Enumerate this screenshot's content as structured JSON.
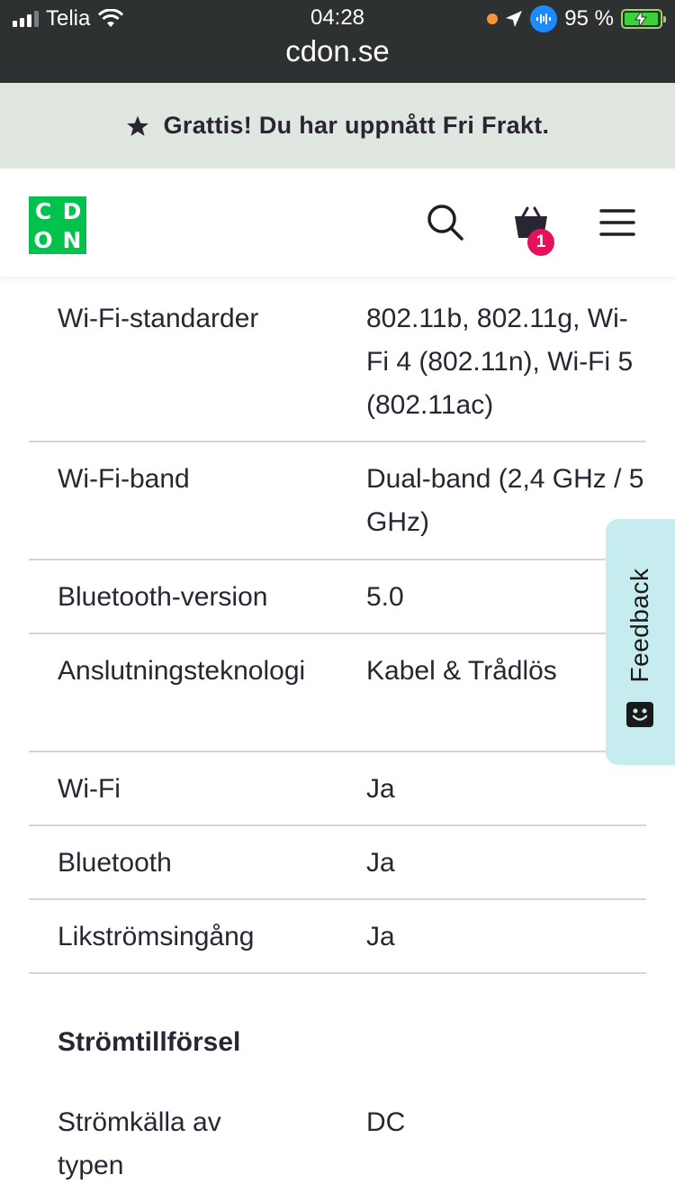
{
  "status_bar": {
    "carrier": "Telia",
    "time": "04:28",
    "battery": "95 %"
  },
  "browser": {
    "url": "cdon.se"
  },
  "promo": {
    "text": "Grattis! Du har uppnått Fri Frakt.",
    "icon": "star-icon"
  },
  "header": {
    "logo_letters": [
      "C",
      "D",
      "O",
      "N"
    ],
    "cart_count": "1",
    "colors": {
      "logo_bg": "#00c24d",
      "badge_bg": "#e5115a"
    }
  },
  "specs": [
    {
      "label": "Wi-Fi-standarder",
      "value": "802.11b, 802.11g, Wi-Fi 4 (802.11n), Wi-Fi 5 (802.11ac)"
    },
    {
      "label": "Wi-Fi-band",
      "value": "Dual-band (2,4 GHz / 5 GHz)"
    },
    {
      "label": "Bluetooth-version",
      "value": "5.0"
    },
    {
      "label": "Anslutningsteknologi",
      "value": "Kabel & Trådlös"
    },
    {
      "label": "Wi-Fi",
      "value": "Ja"
    },
    {
      "label": "Bluetooth",
      "value": "Ja"
    },
    {
      "label": "Likströmsingång",
      "value": "Ja"
    }
  ],
  "section": {
    "title": "Strömtillförsel",
    "rows": [
      {
        "label": "Strömkälla av typen",
        "value": "DC"
      }
    ]
  },
  "feedback": {
    "label": "Feedback"
  }
}
